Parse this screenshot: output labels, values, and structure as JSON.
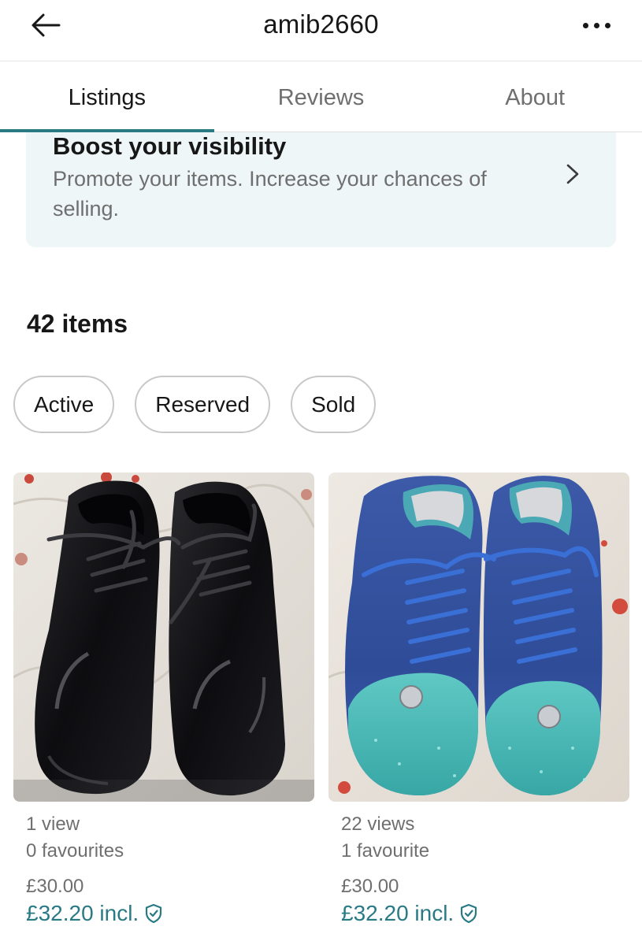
{
  "header": {
    "title": "amib2660"
  },
  "tabs": [
    {
      "label": "Listings",
      "active": true
    },
    {
      "label": "Reviews",
      "active": false
    },
    {
      "label": "About",
      "active": false
    }
  ],
  "banner": {
    "title": "Boost your visibility",
    "subtitle": "Promote your items. Increase your chances of selling."
  },
  "items_count": "42 items",
  "filters": [
    "Active",
    "Reserved",
    "Sold"
  ],
  "listings": [
    {
      "image": "black-patent-leather-lace-up-shoes",
      "views": "1 view",
      "favourites": "0 favourites",
      "price": "£30.00",
      "price_incl": "£32.20 incl."
    },
    {
      "image": "blue-velvet-glitter-toe-sneakers",
      "views": "22 views",
      "favourites": "1 favourite",
      "price": "£30.00",
      "price_incl": "£32.20 incl."
    }
  ],
  "colors": {
    "accent": "#2a7a84",
    "banner_bg": "#eef6f8",
    "muted_text": "#6f6f6f"
  }
}
